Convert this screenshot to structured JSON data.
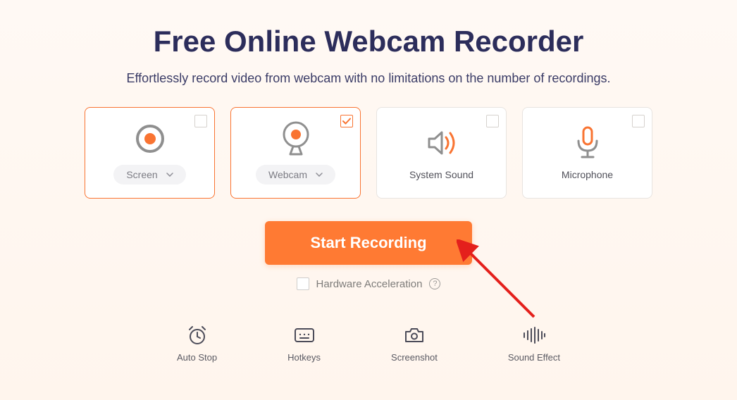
{
  "title": "Free Online Webcam Recorder",
  "subtitle": "Effortlessly record video from webcam with no limitations on the number of recordings.",
  "sources": {
    "screen": {
      "label": "Screen",
      "checked": false,
      "active": true,
      "hasDropdown": true
    },
    "webcam": {
      "label": "Webcam",
      "checked": true,
      "active": true,
      "hasDropdown": true
    },
    "system": {
      "label": "System Sound",
      "checked": false,
      "active": false,
      "hasDropdown": false
    },
    "mic": {
      "label": "Microphone",
      "checked": false,
      "active": false,
      "hasDropdown": false
    }
  },
  "start_button": "Start Recording",
  "hardware_accel": {
    "label": "Hardware Acceleration",
    "checked": false
  },
  "tools": {
    "autostop": {
      "label": "Auto Stop"
    },
    "hotkeys": {
      "label": "Hotkeys"
    },
    "screenshot": {
      "label": "Screenshot"
    },
    "sound": {
      "label": "Sound Effect"
    }
  },
  "colors": {
    "accent": "#FF7A33",
    "accent2": "#F97432",
    "text_dark": "#2C2D5B",
    "grey": "#8F8F8F"
  }
}
